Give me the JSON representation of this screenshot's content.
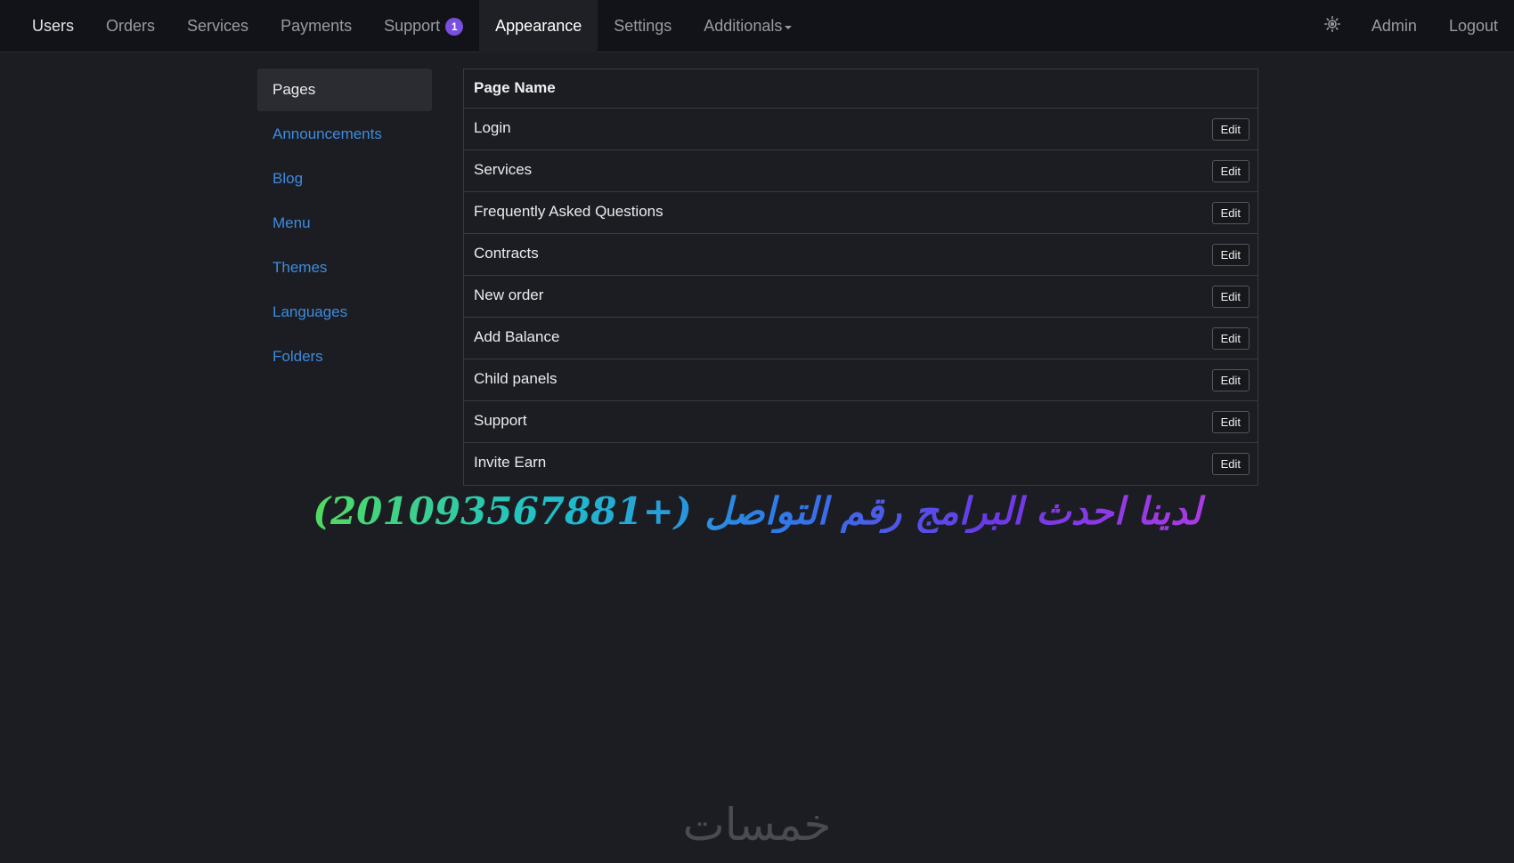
{
  "navbar": {
    "items": [
      {
        "label": "Users"
      },
      {
        "label": "Orders"
      },
      {
        "label": "Services"
      },
      {
        "label": "Payments"
      },
      {
        "label": "Support",
        "badge": "1"
      },
      {
        "label": "Appearance",
        "active": true
      },
      {
        "label": "Settings"
      },
      {
        "label": "Additionals",
        "has_dropdown": true
      }
    ],
    "right": {
      "theme_icon": "sun-icon",
      "admin_label": "Admin",
      "logout_label": "Logout"
    },
    "badge_color": "#7a4fe0"
  },
  "sidebar": {
    "items": [
      {
        "label": "Pages",
        "active": true
      },
      {
        "label": "Announcements"
      },
      {
        "label": "Blog"
      },
      {
        "label": "Menu"
      },
      {
        "label": "Themes"
      },
      {
        "label": "Languages"
      },
      {
        "label": "Folders"
      }
    ],
    "link_color": "#3d8be0"
  },
  "pages_table": {
    "header": "Page Name",
    "edit_label": "Edit",
    "rows": [
      {
        "name": "Login"
      },
      {
        "name": "Services"
      },
      {
        "name": "Frequently Asked Questions"
      },
      {
        "name": "Contracts"
      },
      {
        "name": "New order"
      },
      {
        "name": "Add Balance"
      },
      {
        "name": "Child panels"
      },
      {
        "name": "Support"
      },
      {
        "name": "Invite Earn"
      }
    ]
  },
  "promo_banner": "لدينا احدث البرامج رقم التواصل (+201093567881)",
  "watermark": "خمسات",
  "colors": {
    "background": "#1c1d22",
    "navbar_bg": "#121318",
    "active_nav_bg": "#1f2026",
    "border": "#3a3b42"
  }
}
